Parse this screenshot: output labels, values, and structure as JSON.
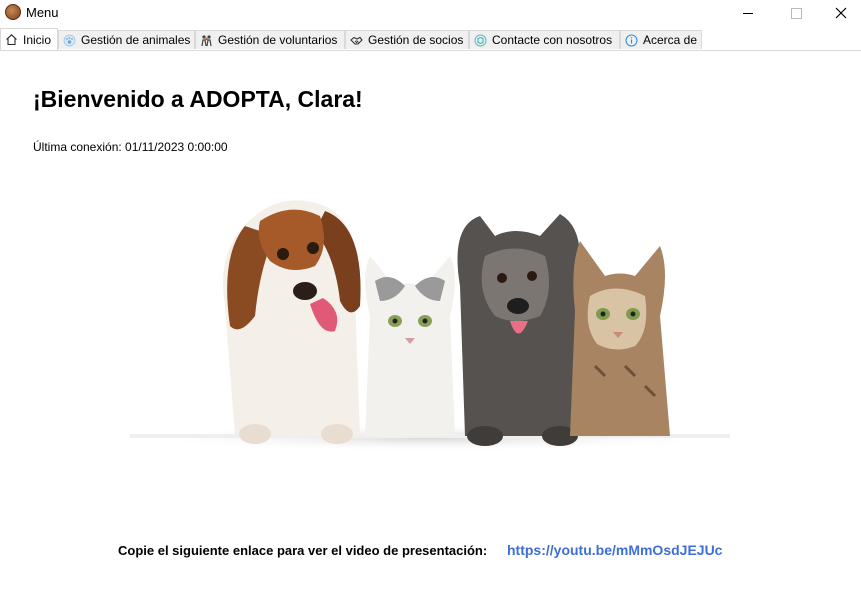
{
  "window": {
    "title": "Menu",
    "app_icon": "dog-logo-icon",
    "controls": [
      "minimize",
      "maximize",
      "close"
    ]
  },
  "tabs": [
    {
      "label": "Inicio",
      "icon": "home-icon",
      "active": true
    },
    {
      "label": "Gestión de animales",
      "icon": "paw-icon",
      "active": false
    },
    {
      "label": "Gestión de voluntarios",
      "icon": "volunteers-icon",
      "active": false
    },
    {
      "label": "Gestión de socios",
      "icon": "handshake-icon",
      "active": false
    },
    {
      "label": "Contacte con nosotros",
      "icon": "contact-icon",
      "active": false
    },
    {
      "label": "Acerca de",
      "icon": "info-icon",
      "active": false
    }
  ],
  "main": {
    "welcome": "¡Bienvenido a ADOPTA, Clara!",
    "last_login": "Última conexión: 01/11/2023 0:00:00",
    "hero_image": "dogs-and-cats-photo",
    "footer_text": "Copie el siguiente enlace para ver el video de presentación:",
    "video_link": "https://youtu.be/mMmOsdJEJUc"
  },
  "colors": {
    "link": "#3d6fd6",
    "tab_active_bg": "#ffffff",
    "tab_inactive_bg": "#f0f0f0",
    "tab_border": "#d9d9d9"
  }
}
